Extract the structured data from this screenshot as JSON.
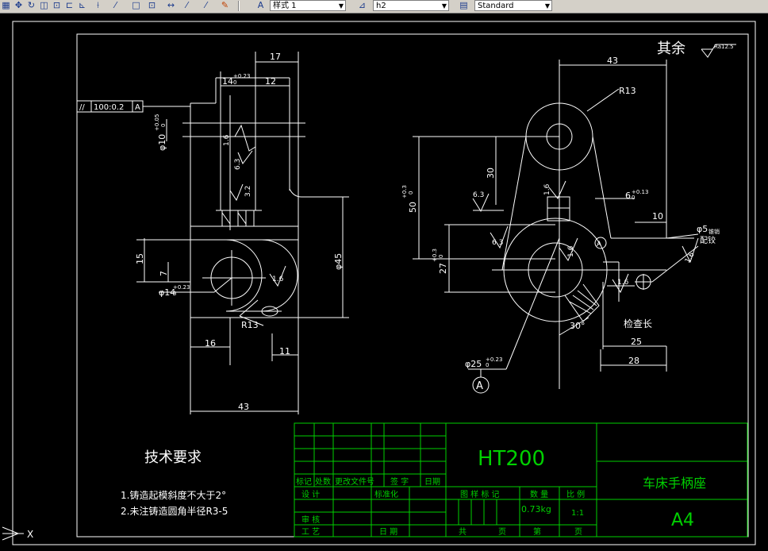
{
  "toolbar": {
    "icons": [
      "grid-icon",
      "pan-icon",
      "orbit-icon",
      "view-icon",
      "zoom-icon",
      "text-style-icon",
      "dim-linear-icon",
      "dim-aligned-icon",
      "dim-box-icon",
      "dim-box2-icon",
      "dim-continue-icon",
      "leader-icon",
      "leader2-icon",
      "dim-edit-icon"
    ],
    "text_style": "样式 1",
    "dim_style": "h2",
    "table_style": "Standard"
  },
  "colors": {
    "drawing": "#ffffff",
    "green": "#00d000",
    "background": "#000000"
  },
  "roughness_note": {
    "label": "其余",
    "value": "Ra12.5"
  },
  "left_view": {
    "dims": {
      "top17": "17",
      "top12": "12",
      "top14": "14",
      "top14_tol": "+0.23",
      "top14_tol0": "0",
      "d10": "φ10",
      "d10_tol": "+0.05",
      "d10_tol0": "0",
      "d45": "φ45",
      "h15": "15",
      "h7": "7",
      "d14": "φ14",
      "d14_tol": "+0.23",
      "d14_tol0": "0",
      "r13": "R13",
      "b16": "16",
      "b11": "11",
      "b43": "43",
      "rough1": "1.6",
      "rough2": "6.3",
      "rough3": "3.2",
      "rough4": "1.6"
    },
    "tolerance_frame": {
      "symbol": "//",
      "value": "100:0.2",
      "datum": "A"
    }
  },
  "right_view": {
    "dims": {
      "top43": "43",
      "r13": "R13",
      "h30": "30",
      "h50": "50",
      "h50_tol": "+0.3",
      "h50_tol0": "0",
      "h27": "27",
      "h27_tol": "+0.3",
      "h27_tol0": "0",
      "r6": "6",
      "r6_tol": "+0.13",
      "r6_tol0": "0",
      "r10": "10",
      "hole": "φ5",
      "hole_note1": "锥销",
      "hole_note2": "配铰",
      "ang30": "30°",
      "check": "检查长",
      "b25": "25",
      "b28": "28",
      "d25": "φ25",
      "d25_tol": "+0.23",
      "d25_tol0": "0",
      "datum": "A",
      "rough_a": "6.3",
      "rough_b": "1.6",
      "rough_c": "6.3",
      "rough_d": "1.6",
      "rough_e": "1.6",
      "rough_f": "1.6"
    }
  },
  "tech_requirements": {
    "title": "技术要求",
    "items": [
      "1.铸造起模斜度不大于2°",
      "2.未注铸造圆角半径R3-5"
    ]
  },
  "title_block": {
    "material": "HT200",
    "part_name": "车床手柄座",
    "paper": "A4",
    "weight": "0.73kg",
    "scale": "1:1",
    "headers": [
      "标记",
      "处数",
      "更改文件号",
      "签 字",
      "日期"
    ],
    "rows": [
      "设 计",
      "审 核",
      "工 艺"
    ],
    "standardize": "标准化",
    "date": "日 期",
    "mark_label": "图 样 标 记",
    "qty_label": "数 量",
    "scale_label": "比 例",
    "total": "共",
    "sheet": "第",
    "page1": "页",
    "page2": "页"
  },
  "ucs": {
    "x_label": "X"
  }
}
